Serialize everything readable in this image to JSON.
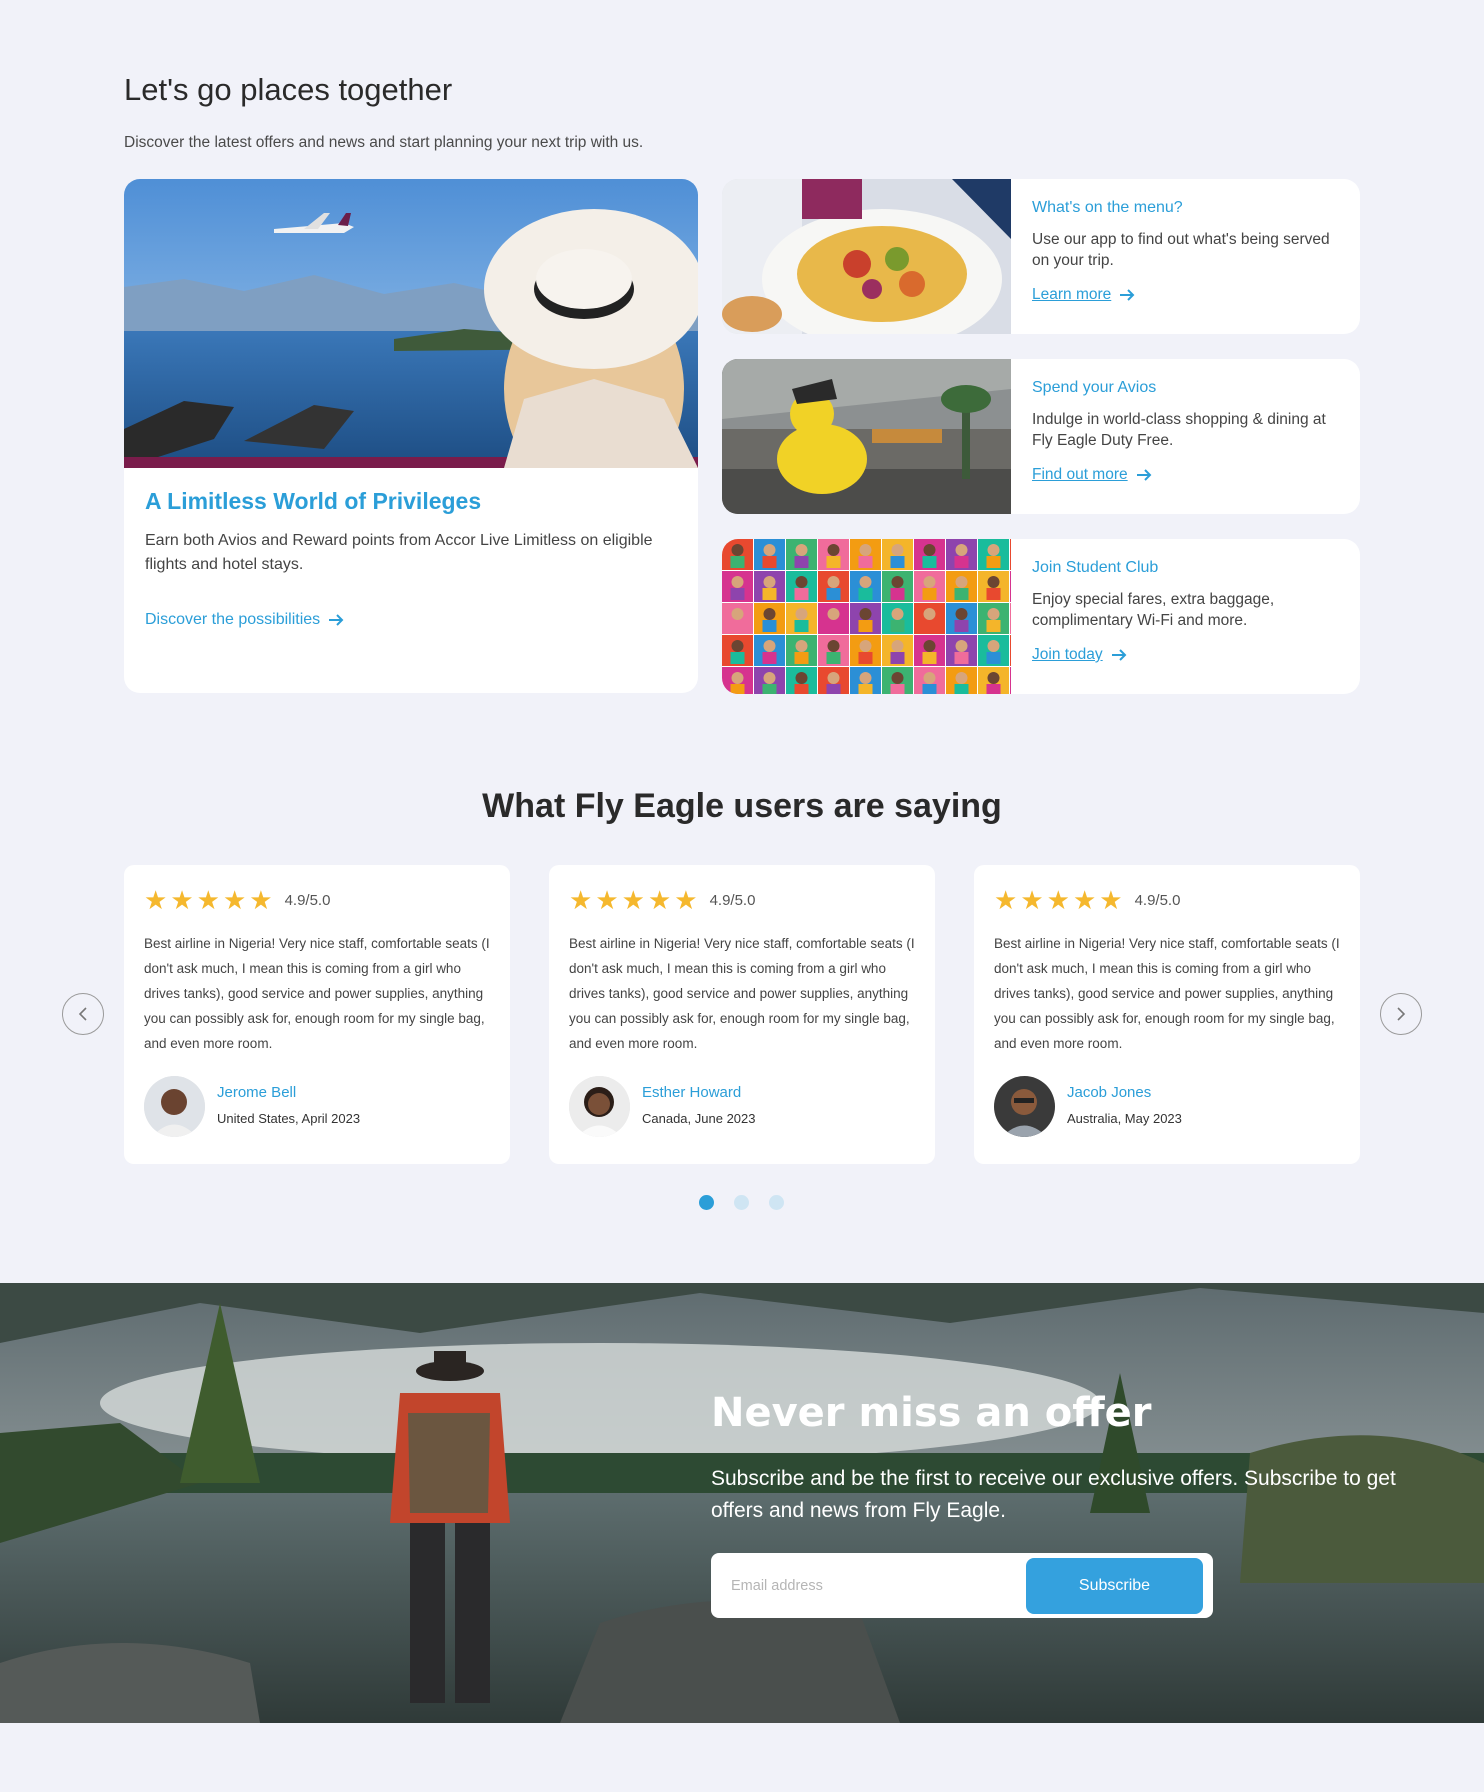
{
  "offers": {
    "title": "Let's go places together",
    "subtitle": "Discover the latest offers and news and start planning your next trip with us.",
    "hero": {
      "title": "A Limitless World of Privileges",
      "text": "Earn both Avios and Reward points from Accor Live Limitless on eligible flights and hotel stays.",
      "link": "Discover the possibilities"
    },
    "cards": [
      {
        "title": "What's on the menu?",
        "text": "Use our app to find out what's being served on your trip.",
        "link": "Learn more"
      },
      {
        "title": "Spend your Avios",
        "text": "Indulge in world-class shopping & dining at Fly Eagle Duty Free.",
        "link": "Find out more"
      },
      {
        "title": "Join Student Club",
        "text": "Enjoy special fares, extra baggage, complimentary Wi-Fi and more.",
        "link": "Join today"
      }
    ]
  },
  "testimonials": {
    "title": "What Fly Eagle users are saying",
    "rating_stars": 5,
    "items": [
      {
        "rating": "4.9/5.0",
        "text": "Best airline in Nigeria! Very nice staff, comfortable seats (I don't ask much, I mean this is coming from a girl who drives tanks), good service and power supplies, anything you can possibly ask for, enough room for my single bag, and even more room.",
        "name": "Jerome Bell",
        "location": "United States, April 2023"
      },
      {
        "rating": "4.9/5.0",
        "text": "Best airline in Nigeria! Very nice staff, comfortable seats (I don't ask much, I mean this is coming from a girl who drives tanks), good service and power supplies, anything you can possibly ask for, enough room for my single bag, and even more room.",
        "name": "Esther Howard",
        "location": "Canada, June 2023"
      },
      {
        "rating": "4.9/5.0",
        "text": "Best airline in Nigeria! Very nice staff, comfortable seats (I don't ask much, I mean this is coming from a girl who drives tanks), good service and power supplies, anything you can possibly ask for, enough room for my single bag, and even more room.",
        "name": "Jacob Jones",
        "location": "Australia, May 2023"
      }
    ],
    "pagination": {
      "pages": 3,
      "active": 1
    }
  },
  "subscribe": {
    "title": "Never miss an offer",
    "text": "Subscribe and be the first to receive our exclusive offers. Subscribe to get offers and news from Fly Eagle.",
    "placeholder": "Email address",
    "button": "Subscribe"
  },
  "colors": {
    "accent": "#2b9ed8",
    "star": "#f5b82e",
    "background": "#f1f2f9",
    "button": "#34a1de"
  }
}
